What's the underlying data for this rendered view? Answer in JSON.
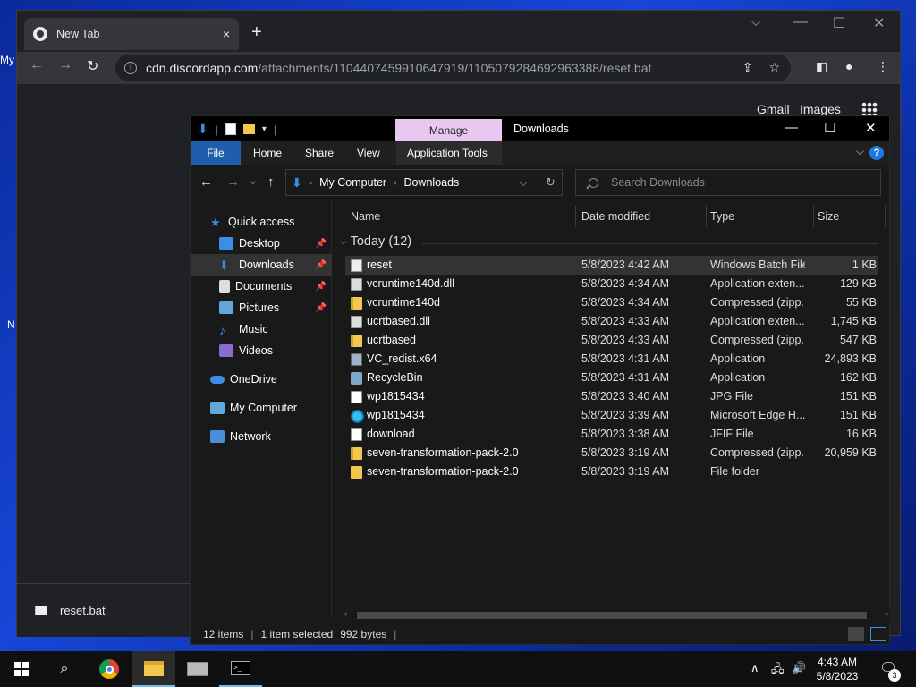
{
  "desktop": {
    "frag1": "My",
    "frag2": "N"
  },
  "chrome": {
    "tab_title": "New Tab",
    "tab_close": "×",
    "new_tab": "+",
    "url_host": "cdn.discordapp.com",
    "url_path": "/attachments/1104407459910647919/1105079284692963388/reset.bat",
    "links": {
      "gmail": "Gmail",
      "images": "Images"
    },
    "download_item": "reset.bat"
  },
  "explorer": {
    "title": "Downloads",
    "manage_tab": "Manage",
    "ribbon": {
      "file": "File",
      "home": "Home",
      "share": "Share",
      "view": "View",
      "app_tools": "Application Tools",
      "help": "?"
    },
    "breadcrumb": [
      "My Computer",
      "Downloads"
    ],
    "search_placeholder": "Search Downloads",
    "nav": {
      "quick_access": "Quick access",
      "desktop": "Desktop",
      "downloads": "Downloads",
      "documents": "Documents",
      "pictures": "Pictures",
      "music": "Music",
      "videos": "Videos",
      "onedrive": "OneDrive",
      "my_computer": "My Computer",
      "network": "Network"
    },
    "columns": {
      "name": "Name",
      "date": "Date modified",
      "type": "Type",
      "size": "Size"
    },
    "group_label": "Today (12)",
    "files": [
      {
        "name": "reset",
        "date": "5/8/2023 4:42 AM",
        "type": "Windows Batch File",
        "size": "1 KB",
        "icon": "batch-file"
      },
      {
        "name": "vcruntime140d.dll",
        "date": "5/8/2023 4:34 AM",
        "type": "Application exten...",
        "size": "129 KB",
        "icon": "dll-file"
      },
      {
        "name": "vcruntime140d",
        "date": "5/8/2023 4:34 AM",
        "type": "Compressed (zipp...",
        "size": "55 KB",
        "icon": "zip-folder"
      },
      {
        "name": "ucrtbased.dll",
        "date": "5/8/2023 4:33 AM",
        "type": "Application exten...",
        "size": "1,745 KB",
        "icon": "dll-file"
      },
      {
        "name": "ucrtbased",
        "date": "5/8/2023 4:33 AM",
        "type": "Compressed (zipp...",
        "size": "547 KB",
        "icon": "zip-folder"
      },
      {
        "name": "VC_redist.x64",
        "date": "5/8/2023 4:31 AM",
        "type": "Application",
        "size": "24,893 KB",
        "icon": "installer"
      },
      {
        "name": "RecycleBin",
        "date": "5/8/2023 4:31 AM",
        "type": "Application",
        "size": "162 KB",
        "icon": "recycle-bin"
      },
      {
        "name": "wp1815434",
        "date": "5/8/2023 3:40 AM",
        "type": "JPG File",
        "size": "151 KB",
        "icon": "image-file"
      },
      {
        "name": "wp1815434",
        "date": "5/8/2023 3:39 AM",
        "type": "Microsoft Edge H...",
        "size": "151 KB",
        "icon": "edge-html"
      },
      {
        "name": "download",
        "date": "5/8/2023 3:38 AM",
        "type": "JFIF File",
        "size": "16 KB",
        "icon": "image-file"
      },
      {
        "name": "seven-transformation-pack-2.0",
        "date": "5/8/2023 3:19 AM",
        "type": "Compressed (zipp...",
        "size": "20,959 KB",
        "icon": "zip-folder"
      },
      {
        "name": "seven-transformation-pack-2.0",
        "date": "5/8/2023 3:19 AM",
        "type": "File folder",
        "size": "",
        "icon": "folder"
      }
    ],
    "status": {
      "count": "12 items",
      "selected": "1 item selected",
      "bytes": "992 bytes"
    }
  },
  "taskbar": {
    "time": "4:43 AM",
    "date": "5/8/2023",
    "notif_count": "3"
  },
  "colors": {
    "accent": "#1f5eab",
    "manage_tab": "#e8c8f0",
    "folder": "#f3c64c"
  }
}
